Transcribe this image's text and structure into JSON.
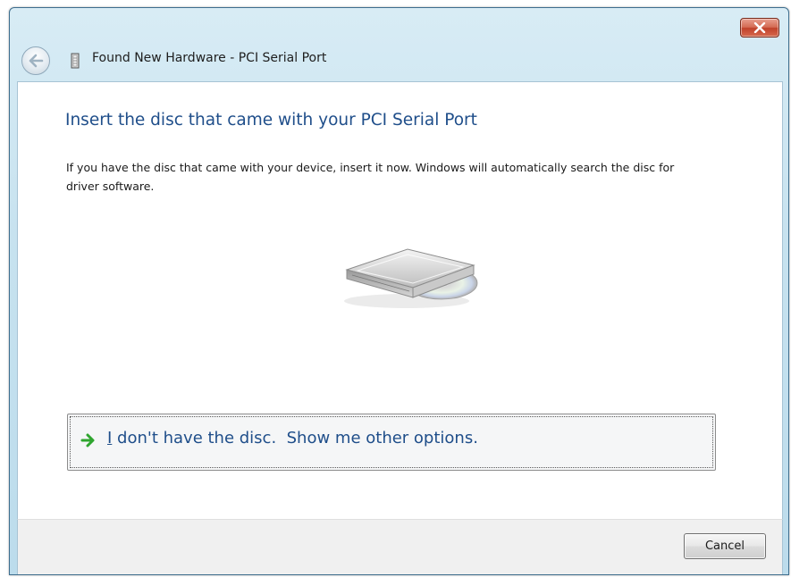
{
  "window": {
    "title": "Found New Hardware - PCI Serial Port"
  },
  "titlebar": {
    "back_icon": "back-arrow-icon",
    "close_icon": "close-icon",
    "device_icon": "device-icon"
  },
  "main": {
    "heading": "Insert the disc that came with your PCI Serial Port",
    "description": "If you have the disc that came with your device, insert it now.  Windows will automatically search the disc for driver software.",
    "illustration_icon": "disc-drive-icon",
    "option": {
      "icon": "green-arrow-icon",
      "accelerator": "I",
      "label_rest": " don't have the disc.  Show me other options."
    }
  },
  "footer": {
    "cancel_label": "Cancel"
  },
  "colors": {
    "heading_blue": "#1f4e8a",
    "frame_blue": "#c7e2ef",
    "close_red": "#c0412a",
    "arrow_green": "#2fa52f"
  }
}
